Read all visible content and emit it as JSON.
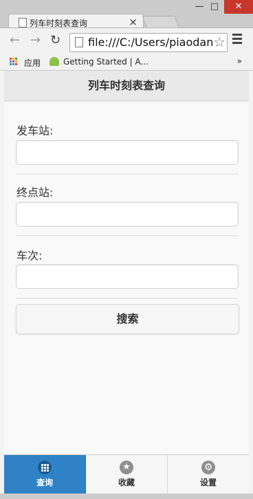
{
  "browser": {
    "tab_title": "列车时刻表查询",
    "tab_close": "×",
    "window_controls": {
      "minimize": "—",
      "maximize": "□",
      "close": "✕"
    },
    "url": "file:///C:/Users/piaodan",
    "back_icon": "←",
    "forward_icon": "→",
    "reload_icon": "↻",
    "star_icon": "☆",
    "bookmarks": {
      "apps_label": "应用",
      "item_label": "Getting Started | A...",
      "more": "»"
    }
  },
  "app": {
    "title": "列车时刻表查询",
    "fields": [
      {
        "label": "发车站:",
        "value": ""
      },
      {
        "label": "终点站:",
        "value": ""
      },
      {
        "label": "车次:",
        "value": ""
      }
    ],
    "search_button": "搜索",
    "navbar": [
      {
        "label": "查询",
        "icon": "grid-icon",
        "active": true
      },
      {
        "label": "收藏",
        "icon": "star-icon",
        "active": false
      },
      {
        "label": "设置",
        "icon": "gear-icon",
        "active": false
      }
    ]
  },
  "colors": {
    "accent": "#2f82c6",
    "close_red": "#c7382b"
  }
}
